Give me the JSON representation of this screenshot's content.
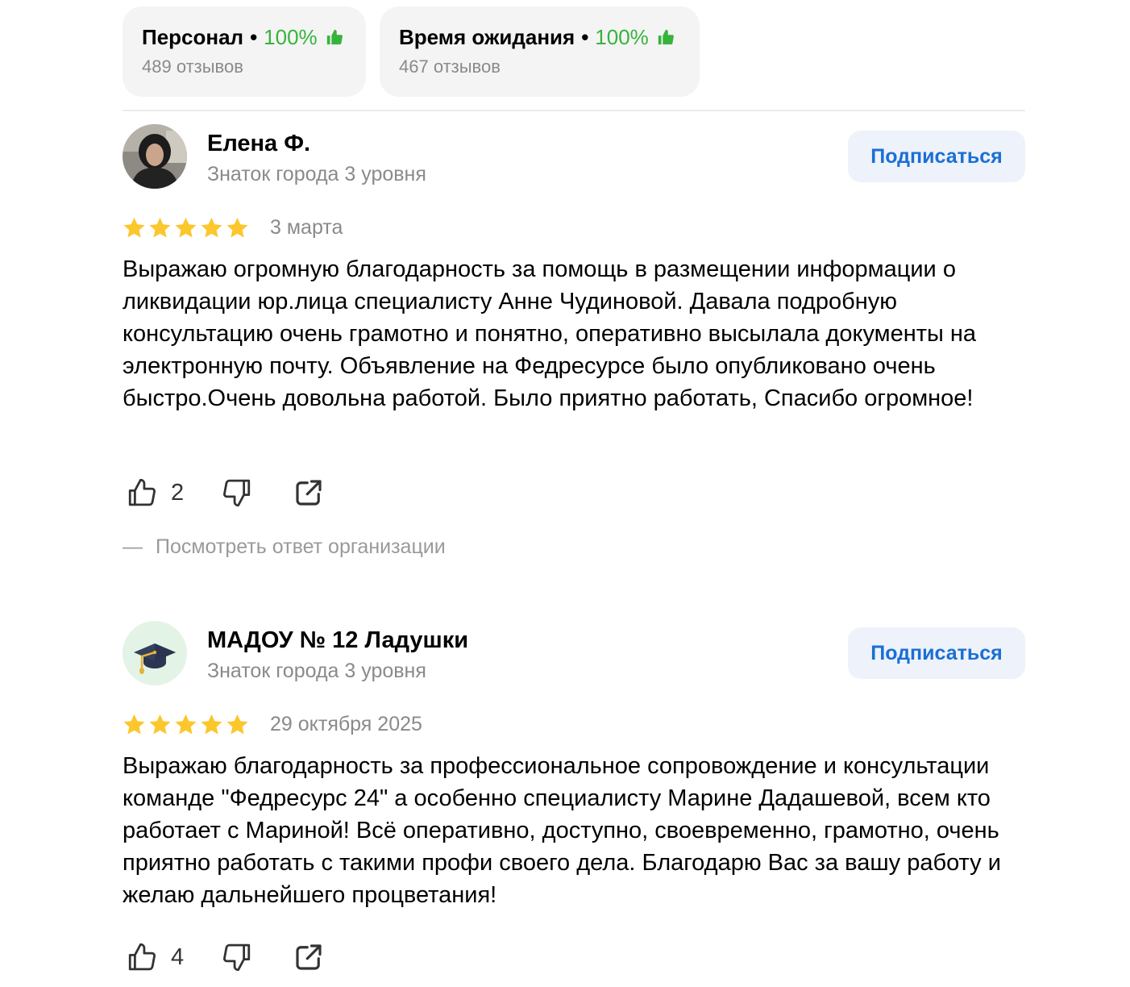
{
  "aspects": [
    {
      "title": "Персонал",
      "percent": "100%",
      "count": "489 отзывов"
    },
    {
      "title": "Время ожидания",
      "percent": "100%",
      "count": "467 отзывов"
    }
  ],
  "reviews": [
    {
      "author": "Елена Ф.",
      "level": "Знаток города 3 уровня",
      "subscribe_label": "Подписаться",
      "rating": 5,
      "date": "3 марта",
      "text": "Выражаю огромную благодарность за помощь в размещении информации о ликвидации юр.лица специалисту Анне Чудиновой. Давала подробную консультацию очень грамотно и понятно, оперативно высылала документы на электронную почту. Объявление на Федресурсе было опубликовано очень быстро.Очень довольна работой. Было приятно работать, Спасибо огромное!",
      "likes": "2",
      "org_reply_label": "Посмотреть ответ организации"
    },
    {
      "author": "МАДОУ № 12 Ладушки",
      "level": "Знаток города 3 уровня",
      "subscribe_label": "Подписаться",
      "rating": 5,
      "date": "29 октября 2025",
      "text": "Выражаю благодарность за профессиональное сопровождение и консультации команде \"Федресурс 24\" а особенно специалисту Марине Дадашевой, всем кто работает с Мариной! Всё оперативно, доступно, своевременно, грамотно, очень приятно работать с такими профи своего дела. Благодарю Вас за вашу работу и желаю дальнейшего процветания!",
      "likes": "4"
    }
  ],
  "colors": {
    "positive": "#36b33c",
    "star": "#fcc72c",
    "link": "#1a6fd4",
    "chip_bg": "#f4f4f4",
    "muted": "#8a8a8a"
  }
}
